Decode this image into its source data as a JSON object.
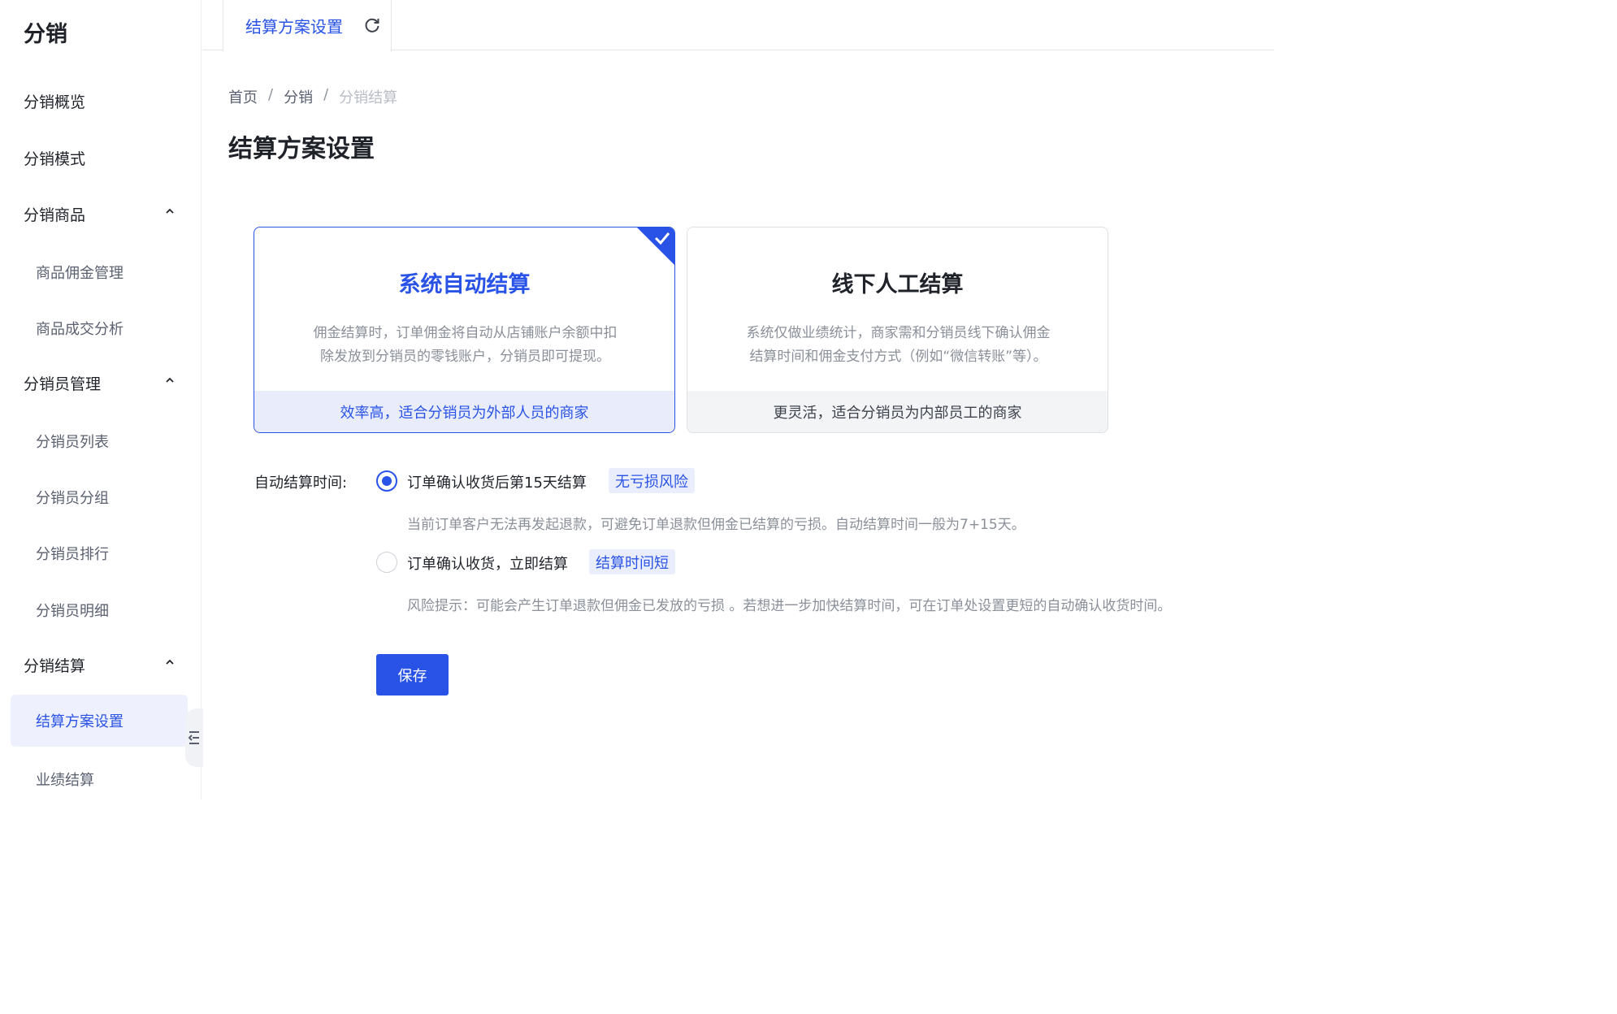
{
  "sidebar": {
    "brand": "分销",
    "items": [
      {
        "label": "分销概览",
        "type": "group"
      },
      {
        "label": "分销模式",
        "type": "group"
      },
      {
        "label": "分销商品",
        "type": "group",
        "expanded": true
      },
      {
        "label": "商品佣金管理",
        "type": "sub"
      },
      {
        "label": "商品成交分析",
        "type": "sub"
      },
      {
        "label": "分销员管理",
        "type": "group",
        "expanded": true
      },
      {
        "label": "分销员列表",
        "type": "sub"
      },
      {
        "label": "分销员分组",
        "type": "sub"
      },
      {
        "label": "分销员排行",
        "type": "sub"
      },
      {
        "label": "分销员明细",
        "type": "sub"
      },
      {
        "label": "分销结算",
        "type": "group",
        "expanded": true
      },
      {
        "label": "结算方案设置",
        "type": "sub",
        "active": true
      },
      {
        "label": "业绩结算",
        "type": "sub"
      }
    ]
  },
  "tabs": [
    {
      "label": "结算方案设置",
      "icon": "refresh-icon"
    }
  ],
  "breadcrumb": [
    "首页",
    "分销",
    "分销结算"
  ],
  "page_title": "结算方案设置",
  "plans": [
    {
      "title": "系统自动结算",
      "desc_line1": "佣金结算时，订单佣金将自动从店铺账户余额中扣",
      "desc_line2": "除发放到分销员的零钱账户，分销员即可提现。",
      "footer": "效率高，适合分销员为外部人员的商家",
      "selected": true
    },
    {
      "title": "线下人工结算",
      "desc_line1": "系统仅做业绩统计，商家需和分销员线下确认佣金",
      "desc_line2": "结算时间和佣金支付方式（例如“微信转账”等）。",
      "footer": "更灵活，适合分销员为内部员工的商家",
      "selected": false
    }
  ],
  "settle_time": {
    "label": "自动结算时间:",
    "options": [
      {
        "label": "订单确认收货后第15天结算",
        "tag": "无亏损风险",
        "desc": "当前订单客户无法再发起退款，可避免订单退款但佣金已结算的亏损。自动结算时间一般为7+15天。",
        "checked": true
      },
      {
        "label": "订单确认收货，立即结算",
        "tag": "结算时间短",
        "desc": "风险提示：可能会产生订单退款但佣金已发放的亏损 。若想进一步加快结算时间，可在订单处设置更短的自动确认收货时间。",
        "checked": false
      }
    ]
  },
  "save_label": "保存",
  "colors": {
    "accent": "#2953e6",
    "accent_bg": "#e9edfb"
  }
}
